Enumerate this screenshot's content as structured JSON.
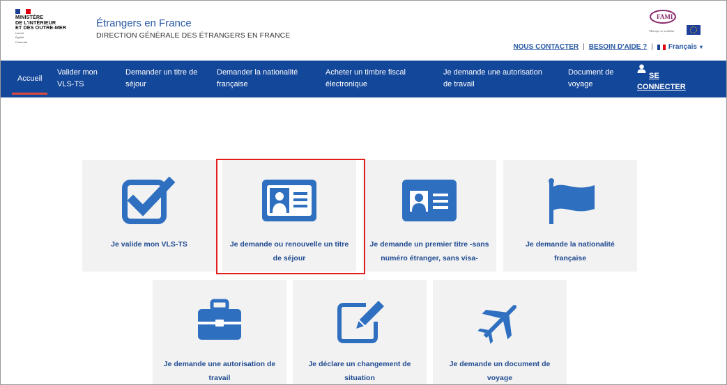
{
  "header": {
    "ministry_lines": [
      "MINISTÈRE",
      "DE L'INTÉRIEUR",
      "ET DES OUTRE-MER"
    ],
    "motto_lines": [
      "Liberté",
      "Égalité",
      "Fraternité"
    ],
    "site_title": "Étrangers en France",
    "site_subtitle": "DIRECTION GÉNÉRALE DES ÉTRANGERS EN FRANCE",
    "contact_link": "NOUS CONTACTER",
    "help_link": "BESOIN D'AIDE ?",
    "separator": "|",
    "language": "Français",
    "fami_logo": "FAMI",
    "fami_caption": "l'Europe se mobilise"
  },
  "nav": {
    "items": [
      {
        "label": "Accueil",
        "line2": ""
      },
      {
        "label": "Valider mon",
        "line2": "VLS-TS"
      },
      {
        "label": "Demander un titre de",
        "line2": "séjour"
      },
      {
        "label": "Demander la nationalité",
        "line2": "française"
      },
      {
        "label": "Acheter un timbre fiscal",
        "line2": "électronique"
      },
      {
        "label": "Je demande une autorisation",
        "line2": "de travail"
      },
      {
        "label": "Document de",
        "line2": "voyage"
      }
    ],
    "connect_line1": "SE",
    "connect_line2": "CONNECTER"
  },
  "tiles": [
    {
      "line1": "Je valide mon VLS-TS",
      "line2": "",
      "icon": "checkbox-icon"
    },
    {
      "line1": "Je demande ou renouvelle un titre",
      "line2": "de séjour",
      "icon": "id-card-icon"
    },
    {
      "line1": "Je demande un premier titre -sans",
      "line2": "numéro étranger, sans visa-",
      "icon": "id-card-icon"
    },
    {
      "line1": "Je demande la nationalité",
      "line2": "française",
      "icon": "flag-icon"
    },
    {
      "line1": "Je demande une autorisation de",
      "line2": "travail",
      "icon": "briefcase-icon"
    },
    {
      "line1": "Je déclare un changement de",
      "line2": "situation",
      "icon": "edit-icon"
    },
    {
      "line1": "Je demande un document de",
      "line2": "voyage",
      "icon": "airplane-icon"
    }
  ],
  "colors": {
    "nav_bg": "#13479a",
    "accent_red": "#e14b3b",
    "icon_blue": "#2f6fc0",
    "tile_bg": "#f2f2f2",
    "highlight": "#e31c1c"
  }
}
